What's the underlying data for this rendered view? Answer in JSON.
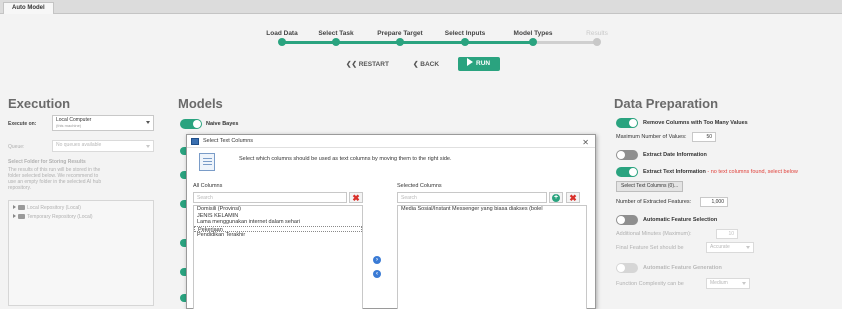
{
  "tabs": [
    {
      "label": "Auto Model"
    }
  ],
  "wizard": {
    "steps": [
      {
        "label": "Load Data",
        "done": true
      },
      {
        "label": "Select Task",
        "done": true
      },
      {
        "label": "Prepare Target",
        "done": true
      },
      {
        "label": "Select Inputs",
        "done": true
      },
      {
        "label": "Model Types",
        "done": true
      },
      {
        "label": "Results",
        "done": false
      }
    ],
    "restart_label": "RESTART",
    "back_label": "BACK",
    "run_label": "RUN"
  },
  "execution": {
    "title": "Execution",
    "execute_on_label": "Execute on:",
    "execute_on_value": "Local Computer",
    "execute_on_sub": "(this machine)",
    "queue_label": "Queue:",
    "queue_value": "No queues available",
    "folder_title": "Select Folder for Storing Results",
    "folder_help": [
      "The results of this run will be stored in the",
      "folder selected below. We recommend to",
      "use an empty folder in the selected AI hub",
      "repository."
    ],
    "repos": [
      "Local Repository (Local)",
      "Temporary Repository (Local)"
    ]
  },
  "models": {
    "title": "Models",
    "items": [
      {
        "label": "Naive Bayes",
        "enabled": true
      }
    ]
  },
  "data_prep": {
    "title": "Data Preparation",
    "remove_cols_label": "Remove Columns with Too Many Values",
    "max_values_label": "Maximum Number of Values:",
    "max_values": "50",
    "extract_date_label": "Extract Date Information",
    "extract_text_label": "Extract Text Information",
    "extract_text_warning": "- no text columns found, select below",
    "select_text_btn": "Select Text Columns (0)...",
    "num_features_label": "Number of Extracted Features:",
    "num_features": "1,000",
    "auto_feat_sel_label": "Automatic Feature Selection",
    "additional_minutes_label": "Additional Minutes (Maximum):",
    "additional_minutes": "10",
    "final_feature_label": "Final Feature Set should be",
    "final_feature_value": "Accurate",
    "auto_feat_gen_label": "Automatic Feature Generation",
    "func_complexity_label": "Function Complexity can be",
    "func_complexity_value": "Medium"
  },
  "dialog": {
    "title": "Select Text Columns",
    "message": "Select which columns should be used as text columns by moving them to the right side.",
    "all_columns_label": "All Columns",
    "selected_columns_label": "Selected Columns",
    "search_placeholder": "Search",
    "all_columns": [
      "Domisili (Provinsi)",
      "JENIS KELAMIN",
      "Lama menggunakan internet dalam sehari",
      "Pekerjaan",
      "Pendidikan Terakhir"
    ],
    "selected_columns": [
      "Media Sosial/Instant Messenger yang biasa diakses (bolel"
    ]
  },
  "colors": {
    "accent": "#2aa37f",
    "warning": "#e0403a",
    "move_button": "#3a7bd5"
  }
}
